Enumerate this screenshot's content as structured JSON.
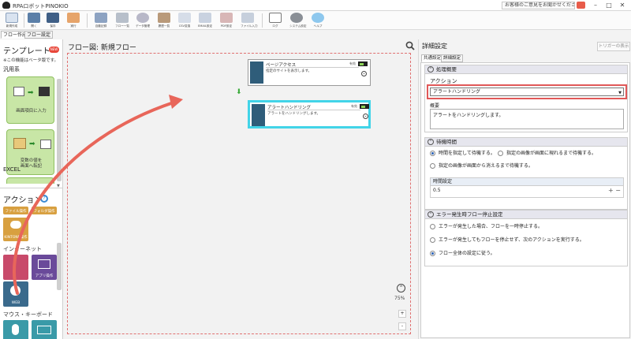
{
  "titlebar": {
    "app_title": "RPAロボットPINOKIO",
    "feedback_label": "お客様のご意見をお聞かせください",
    "min_icon": "minimize-icon",
    "max_icon": "maximize-icon",
    "close_icon": "close-icon"
  },
  "toolbar": {
    "items": [
      {
        "label": "新規作成",
        "color": "#d9e3f0"
      },
      {
        "label": "開く",
        "color": "#5b7fa8"
      },
      {
        "label": "保存",
        "color": "#3f5f86"
      },
      {
        "label": "実行",
        "color": "#e6a46a"
      },
      {
        "label": "自動記録",
        "color": "#8da3c2"
      },
      {
        "label": "フロー一覧",
        "color": "#b7bfca"
      },
      {
        "label": "データ管理",
        "color": "#b8b8c8"
      },
      {
        "label": "履歴一覧",
        "color": "#b99a7a"
      },
      {
        "label": "CSV変換",
        "color": "#d6dde8"
      },
      {
        "label": "EMAIL設定",
        "color": "#c9d2e0"
      },
      {
        "label": "PDF設定",
        "color": "#d8b6b6"
      },
      {
        "label": "ファイル入力",
        "color": "#c6cfdc"
      },
      {
        "label": "ログ",
        "color": "#c9c9c9"
      },
      {
        "label": "システム設定",
        "color": "#8a8f96"
      },
      {
        "label": "ヘルプ",
        "color": "#8ec8ee"
      }
    ]
  },
  "mode_tabs": [
    "フロー作成",
    "フロー設定"
  ],
  "left_panel": {
    "template_title": "テンプレート",
    "new_badge": "NEW",
    "note": "※この機能はベータ版です。",
    "general_section": "汎用系",
    "template_cards": [
      "画面項目に入力",
      "変数の値を\n画面へ転記"
    ],
    "excel_section": "EXCEL",
    "action_title": "アクション",
    "help_icon": "help-icon",
    "file_ops": "ファイル操作",
    "folder_ops": "フォルダ操作",
    "kintone_label": "KINTONE操作",
    "internet_section": "インターネット",
    "app_ops": "アプリ操作",
    "web_tile": "WEB",
    "mouse_keyboard_section": "マウス・キーボード"
  },
  "flow": {
    "title": "フロー図:  新規フロー",
    "zoom_level": "75%",
    "zoom_in": "+",
    "zoom_out": "-",
    "nodes": [
      {
        "title": "ページアクセス",
        "desc": "指定のサイトを表示します。",
        "status": "有効",
        "selected": false
      },
      {
        "title": "アラートハンドリング",
        "desc": "アラートをハンドリングします。",
        "status": "有効",
        "selected": true
      }
    ]
  },
  "right_panel": {
    "title": "詳細設定",
    "trigger_button": "トリガーの表示",
    "tabs": [
      "共通設定",
      "詳細設定"
    ],
    "section_processing": "処理概要",
    "action_label": "アクション",
    "action_value": "アラートハンドリング",
    "summary_label": "概要",
    "summary_value": "アラートをハンドリングします。",
    "section_wait": "待機時間",
    "wait_options": [
      {
        "label": "時間を指定して待機する。",
        "selected": true
      },
      {
        "label": "指定の画像が画面に現れるまで待機する。",
        "selected": false
      },
      {
        "label": "指定の画像が画面から消えるまで待機する。",
        "selected": false
      }
    ],
    "time_setting_label": "時間設定",
    "time_value": "0.5",
    "stepper": "+ −",
    "section_error": "エラー発生時フロー停止設定",
    "error_options": [
      {
        "label": "エラーが発生した場合、フローを一時停止する。",
        "selected": false
      },
      {
        "label": "エラーが発生してもフローを停止せず、次のアクションを実行する。",
        "selected": false
      },
      {
        "label": "フロー全体の設定に従う。",
        "selected": true
      }
    ]
  },
  "colors": {
    "accent_red": "#e05858",
    "selected_cyan": "#42d4e8",
    "template_green": "#c8e6a6",
    "web_tile": "#3a6a8c"
  }
}
